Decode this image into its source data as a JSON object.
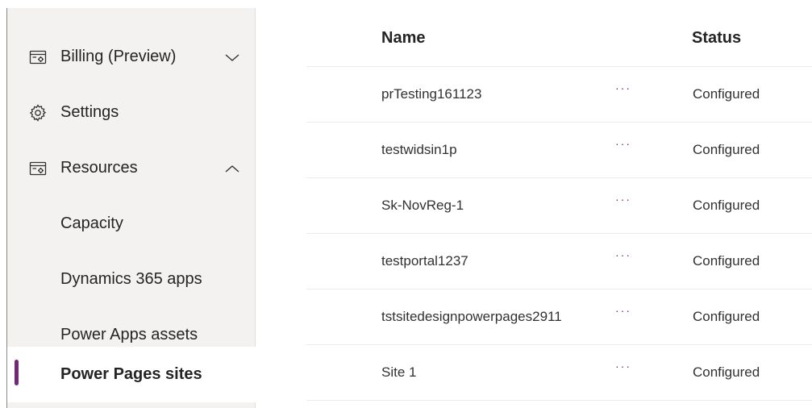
{
  "sidebar": {
    "items": [
      {
        "label": "Billing (Preview)",
        "icon": "billing-icon",
        "chevron": "chevron-down-icon"
      },
      {
        "label": "Settings",
        "icon": "gear-icon"
      },
      {
        "label": "Resources",
        "icon": "resources-icon",
        "chevron": "chevron-up-icon"
      },
      {
        "label": "Capacity"
      },
      {
        "label": "Dynamics 365 apps"
      },
      {
        "label": "Power Apps assets"
      },
      {
        "label": "Power Pages sites",
        "selected": true
      }
    ]
  },
  "list": {
    "columns": {
      "name": "Name",
      "status": "Status"
    },
    "more_glyph": "···",
    "rows": [
      {
        "name": "prTesting161123",
        "status": "Configured"
      },
      {
        "name": "testwidsin1p",
        "status": "Configured"
      },
      {
        "name": "Sk-NovReg-1",
        "status": "Configured"
      },
      {
        "name": "testportal1237",
        "status": "Configured"
      },
      {
        "name": "tstsitedesignpowerpages2911",
        "status": "Configured"
      },
      {
        "name": "Site 1",
        "status": "Configured"
      }
    ]
  },
  "colors": {
    "accent": "#742774",
    "sidebar_bg": "#f3f2f1",
    "divider": "#edebe9"
  }
}
